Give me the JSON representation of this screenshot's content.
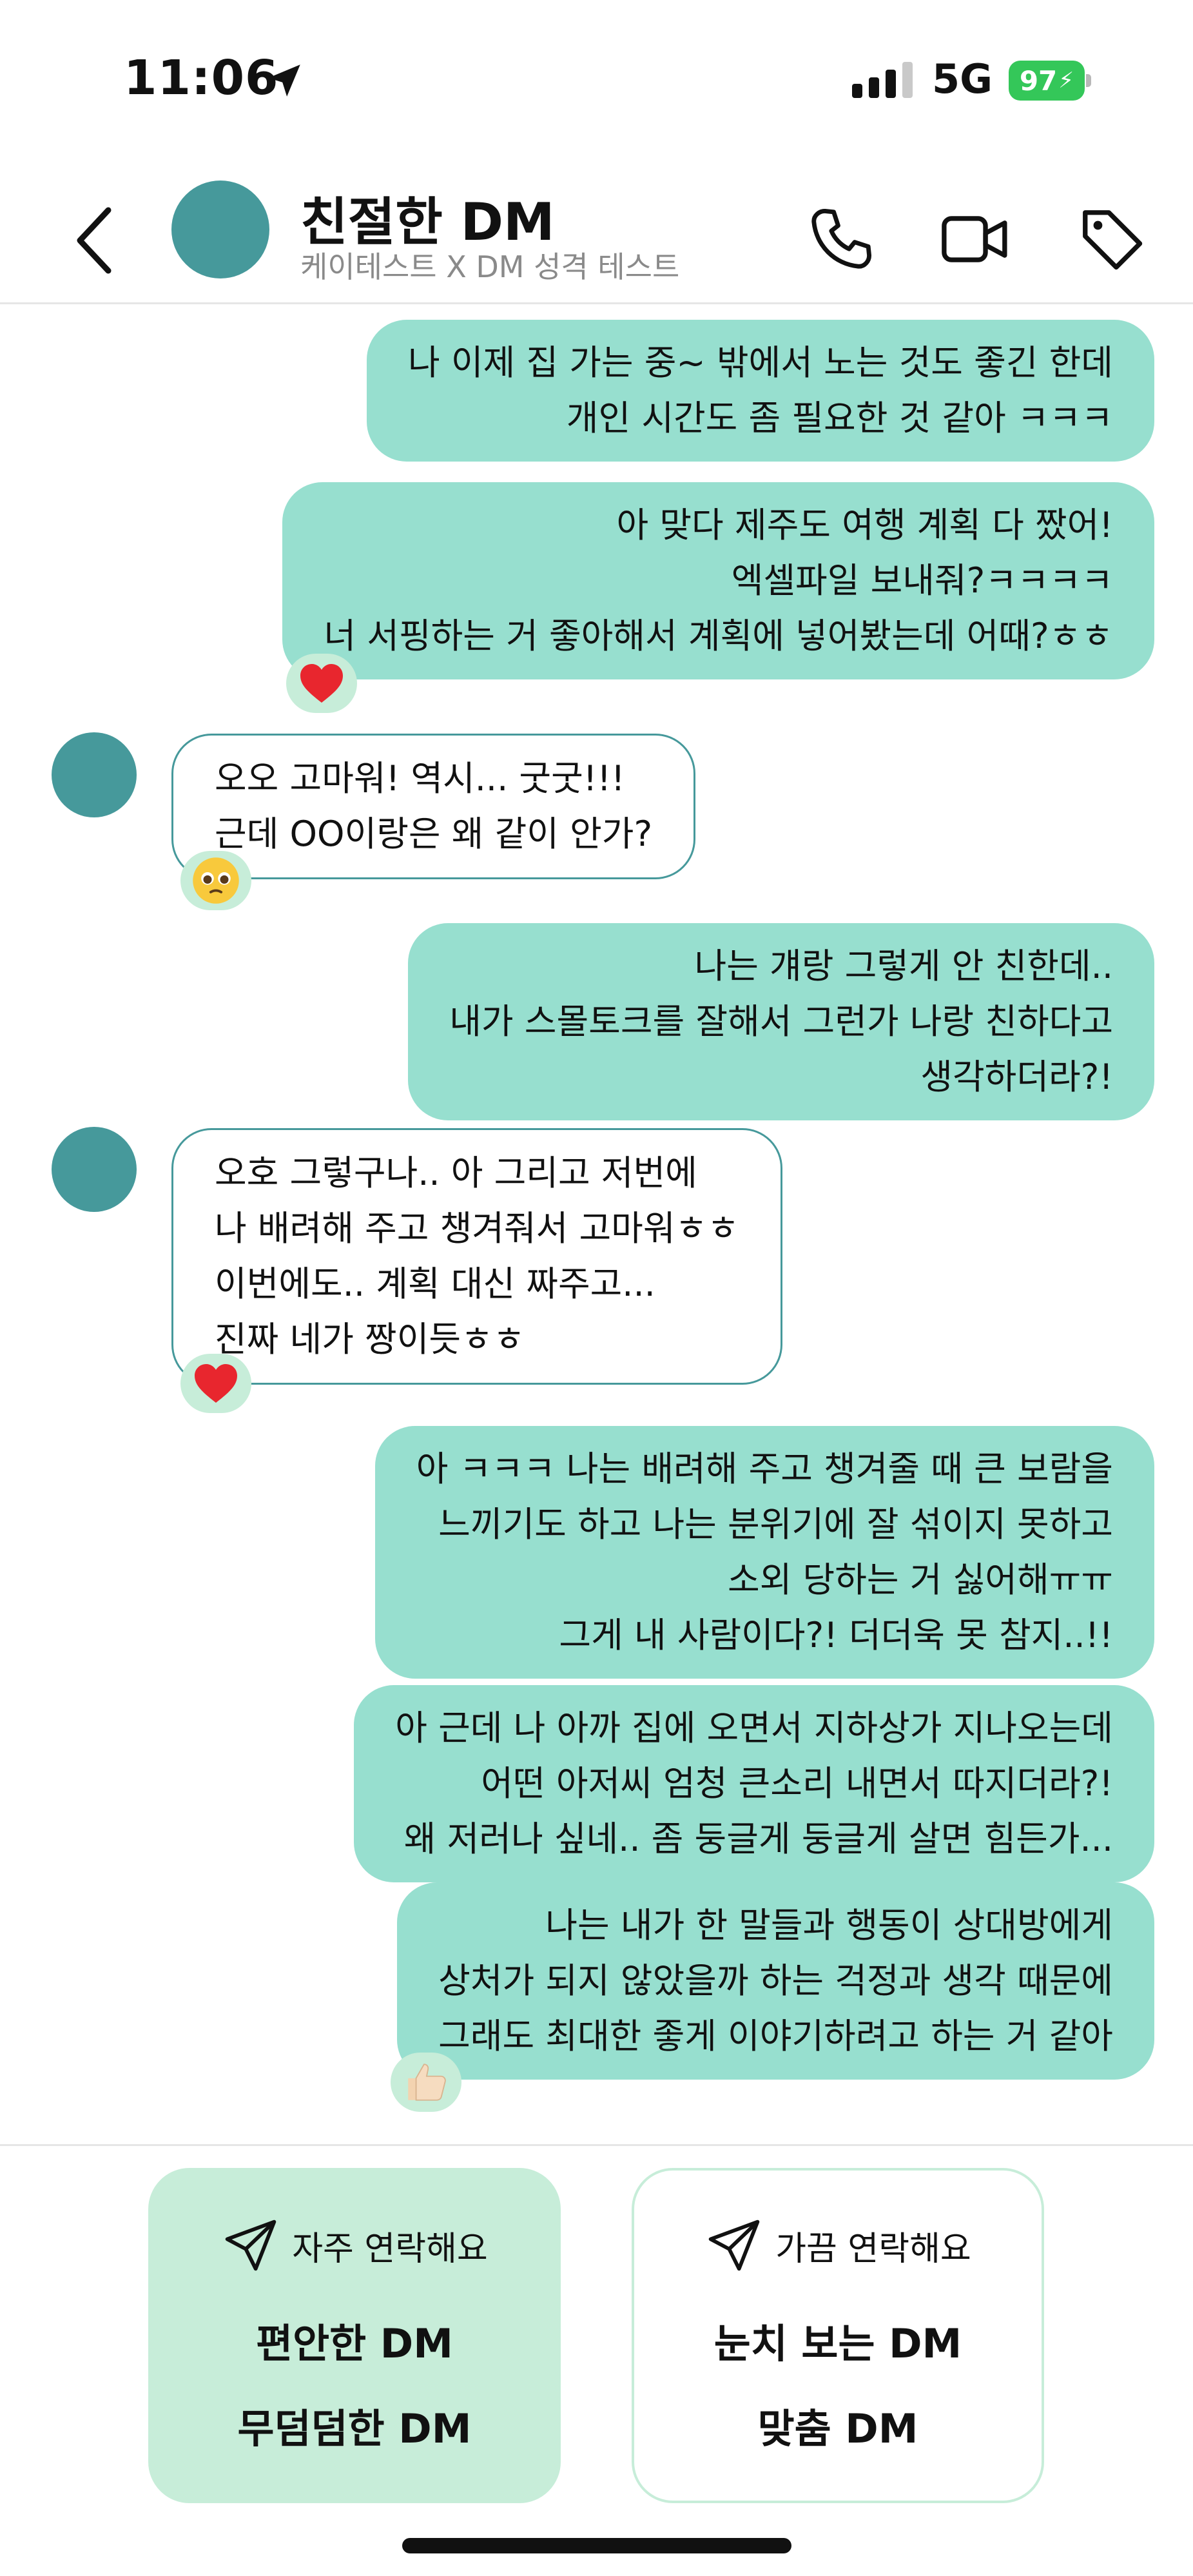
{
  "status_bar": {
    "time": "11:06",
    "network": "5G",
    "battery": "97"
  },
  "header": {
    "title": "친절한 DM",
    "subtitle": "케이테스트 X DM 성격 테스트"
  },
  "messages": [
    {
      "type": "sent",
      "lines": [
        "나 이제 집 가는 중~ 밖에서 노는 것도 좋긴 한데",
        "개인 시간도 좀 필요한 것 같아 ㅋㅋㅋ"
      ]
    },
    {
      "type": "sent",
      "lines": [
        "아 맞다 제주도 여행 계획 다 짰어!",
        "엑셀파일 보내줘?ㅋㅋㅋㅋ",
        "너 서핑하는 거 좋아해서 계획에 넣어봤는데 어때?ㅎㅎ"
      ],
      "reaction": "heart-icon"
    },
    {
      "type": "received",
      "lines": [
        "오오 고마워! 역시... 굿굿!!!",
        "근데 OO이랑은 왜 같이 안가?"
      ],
      "reaction": "pleading-face-icon"
    },
    {
      "type": "sent",
      "lines": [
        "나는 걔랑 그렇게 안 친한데..",
        "내가 스몰토크를 잘해서 그런가 나랑 친하다고",
        "생각하더라?!"
      ]
    },
    {
      "type": "received",
      "lines": [
        "오호 그렇구나.. 아 그리고 저번에",
        "나 배려해 주고 챙겨줘서 고마워ㅎㅎ",
        "이번에도.. 계획 대신 짜주고...",
        "진짜 네가 짱이듯ㅎㅎ"
      ],
      "reaction": "heart-icon"
    },
    {
      "type": "sent",
      "lines": [
        "아 ㅋㅋㅋ 나는 배려해 주고 챙겨줄 때 큰 보람을",
        "느끼기도 하고 나는 분위기에 잘 섞이지 못하고",
        "소외 당하는 거 싫어해ㅠㅠ",
        "그게 내 사람이다?! 더더욱 못 참지..!!"
      ]
    },
    {
      "type": "sent",
      "lines": [
        "아 근데 나 아까 집에 오면서 지하상가 지나오는데",
        "어떤 아저씨 엄청 큰소리 내면서 따지더라?!",
        "왜 저러나 싶네.. 좀 둥글게 둥글게 살면 힘든가..."
      ]
    },
    {
      "type": "sent",
      "lines": [
        "나는 내가 한 말들과 행동이 상대방에게",
        "상처가 되지 않았을까 하는 걱정과 생각 때문에",
        "그래도 최대한 좋게 이야기하려고 하는 거 같아"
      ],
      "reaction": "thumbs-up-icon"
    }
  ],
  "options": [
    {
      "header": "자주 연락해요",
      "lines": [
        "편안한 DM",
        "무덤덤한 DM"
      ],
      "icon": "send-icon",
      "fill": "#c7edd9"
    },
    {
      "header": "가끔 연락해요",
      "lines": [
        "눈치 보는 DM",
        "맞춤 DM"
      ],
      "icon": "send-icon",
      "fill": "#ffffff"
    }
  ],
  "colors": {
    "sent_bubble": "#97dfcf",
    "avatar": "#46999b",
    "reaction_bg": "#c7edd9",
    "battery": "#34c759"
  }
}
